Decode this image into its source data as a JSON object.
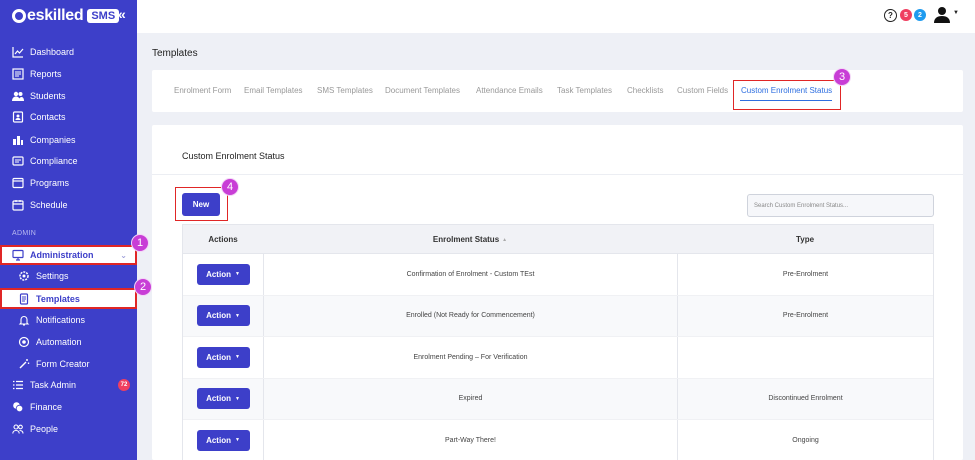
{
  "brand": {
    "name": "eskilled",
    "product": "SMS"
  },
  "topbar": {
    "help_icon": "?",
    "badge_red": "5",
    "badge_blue": "2",
    "colors": {
      "red": "#ef3f60",
      "blue": "#1f9bef"
    }
  },
  "sidebar": {
    "items": [
      {
        "label": "Dashboard",
        "icon": "chart-line-icon"
      },
      {
        "label": "Reports",
        "icon": "report-icon"
      },
      {
        "label": "Students",
        "icon": "students-icon"
      },
      {
        "label": "Contacts",
        "icon": "contacts-icon"
      },
      {
        "label": "Companies",
        "icon": "companies-icon"
      },
      {
        "label": "Compliance",
        "icon": "compliance-icon"
      },
      {
        "label": "Programs",
        "icon": "programs-icon"
      },
      {
        "label": "Schedule",
        "icon": "schedule-icon"
      }
    ],
    "admin_heading": "ADMIN",
    "administration": "Administration",
    "sub_items": [
      {
        "label": "Settings",
        "icon": "gear-icon"
      },
      {
        "label": "Templates",
        "icon": "document-icon"
      },
      {
        "label": "Notifications",
        "icon": "bell-icon"
      },
      {
        "label": "Automation",
        "icon": "automation-icon"
      },
      {
        "label": "Form Creator",
        "icon": "magic-wand-icon"
      }
    ],
    "bottom_items": [
      {
        "label": "Task Admin",
        "icon": "task-list-icon",
        "badge": "72"
      },
      {
        "label": "Finance",
        "icon": "finance-icon"
      },
      {
        "label": "People",
        "icon": "people-icon"
      }
    ]
  },
  "page": {
    "title": "Templates"
  },
  "tabs": [
    "Enrolment Form",
    "Email Templates",
    "SMS Templates",
    "Document Templates",
    "Attendance Emails",
    "Task Templates",
    "Checklists",
    "Custom Fields",
    "Custom Enrolment Status"
  ],
  "active_tab": "Custom Enrolment Status",
  "card": {
    "title": "Custom Enrolment Status",
    "new_button": "New",
    "search_placeholder": "Search Custom Enrolment Status..."
  },
  "table": {
    "headers": {
      "actions": "Actions",
      "status": "Enrolment Status",
      "type": "Type"
    },
    "sort_indicator": "▲",
    "action_label": "Action",
    "rows": [
      {
        "status": "Confirmation of Enrolment - Custom TEst",
        "type": "Pre-Enrolment"
      },
      {
        "status": "Enrolled (Not Ready for Commencement)",
        "type": "Pre-Enrolment"
      },
      {
        "status": "Enrolment Pending – For Verification",
        "type": ""
      },
      {
        "status": "Expired",
        "type": "Discontinued Enrolment"
      },
      {
        "status": "Part-Way There!",
        "type": "Ongoing"
      }
    ]
  },
  "steps": [
    "1",
    "2",
    "3",
    "4"
  ],
  "accent_color": "#3d3fc9",
  "highlight_color": "#e02626"
}
